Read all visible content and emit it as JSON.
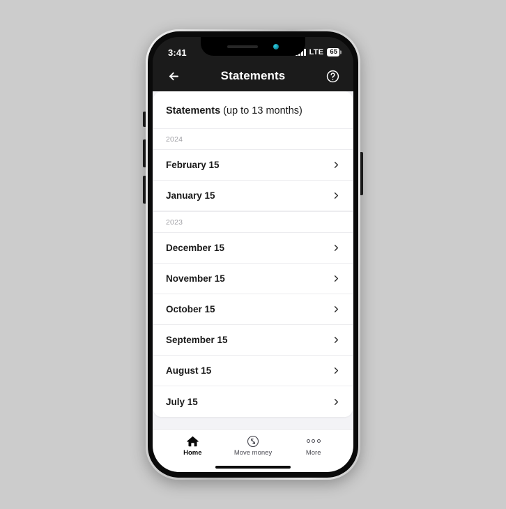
{
  "device": {
    "status_bar": {
      "time": "3:41",
      "signal_icon": "cellular-signal-icon",
      "network_label": "LTE",
      "battery_level": "65"
    },
    "home_indicator": "home-indicator"
  },
  "header": {
    "back_icon": "back-arrow-icon",
    "title": "Statements",
    "help_icon": "help-circle-icon"
  },
  "main": {
    "card_title_bold": "Statements",
    "card_title_rest": " (up to 13 months)",
    "sections": [
      {
        "year": "2024",
        "items": [
          {
            "label": "February 15"
          },
          {
            "label": "January 15"
          }
        ]
      },
      {
        "year": "2023",
        "items": [
          {
            "label": "December 15"
          },
          {
            "label": "November 15"
          },
          {
            "label": "October 15"
          },
          {
            "label": "September 15"
          },
          {
            "label": "August 15"
          },
          {
            "label": "July 15"
          }
        ]
      }
    ],
    "chevron_icon": "chevron-right-icon"
  },
  "tab_bar": {
    "tabs": [
      {
        "label": "Home",
        "icon": "home-icon",
        "active": true
      },
      {
        "label": "Move money",
        "icon": "transfer-circle-icon",
        "active": false
      },
      {
        "label": "More",
        "icon": "more-dots-icon",
        "active": false
      }
    ]
  },
  "colors": {
    "page_background": "#cccccc",
    "status_bar": "#1b1b1b",
    "card": "#ffffff",
    "content_background": "#f3f3f6",
    "text_primary": "#1a1a1a",
    "text_muted": "#a0a0a5",
    "divider": "#ececef"
  }
}
